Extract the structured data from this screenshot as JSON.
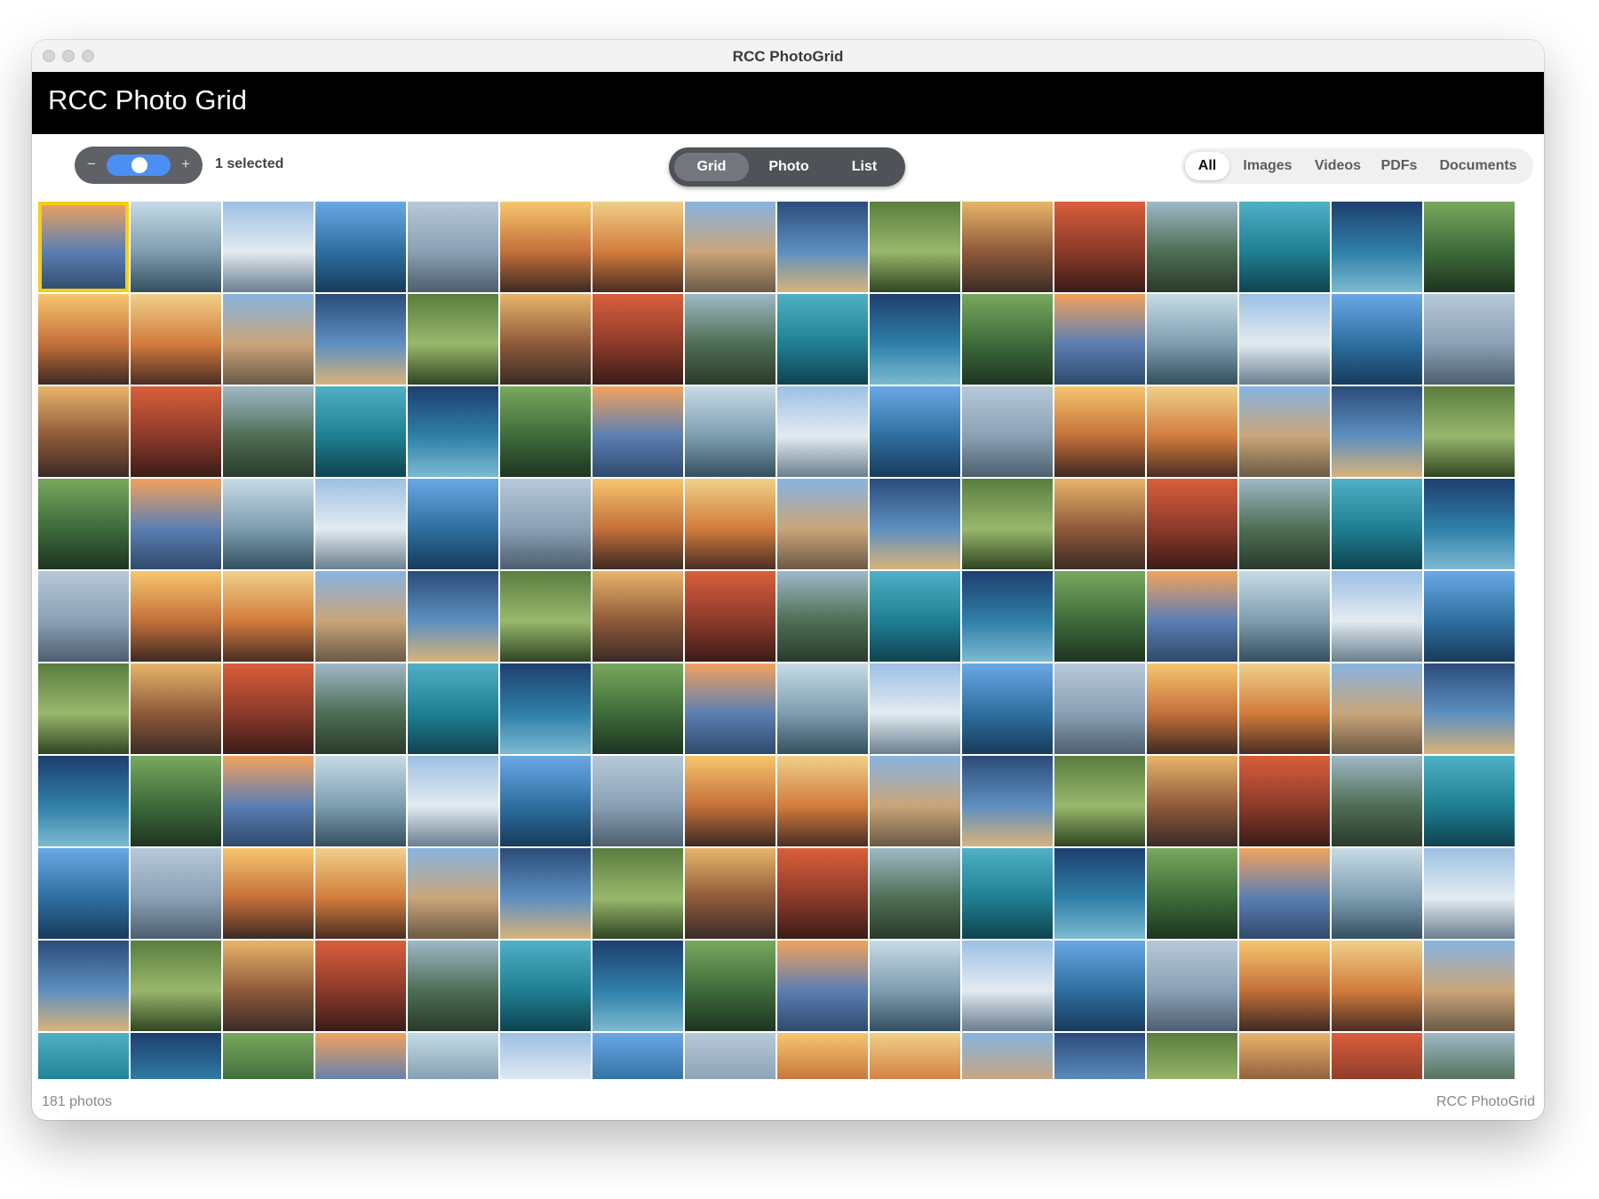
{
  "window": {
    "title": "RCC PhotoGrid"
  },
  "header": {
    "title": "RCC Photo Grid"
  },
  "toolbar": {
    "zoom_minus": "−",
    "zoom_plus": "+",
    "selected_text": "1 selected",
    "view_modes": {
      "grid": "Grid",
      "photo": "Photo",
      "list": "List"
    },
    "active_view": "Grid"
  },
  "filters": {
    "all": "All",
    "images": "Images",
    "videos": "Videos",
    "pdfs": "PDFs",
    "documents": "Documents",
    "active": "All"
  },
  "grid": {
    "columns": 16,
    "visible_rows": 10,
    "selected_index": 0
  },
  "footer": {
    "photo_count": "181 photos",
    "brand": "RCC PhotoGrid"
  },
  "colors": {
    "accent_blue": "#4b8ff5",
    "selection_yellow": "#f3cf17",
    "appbar_bg": "#000000"
  }
}
